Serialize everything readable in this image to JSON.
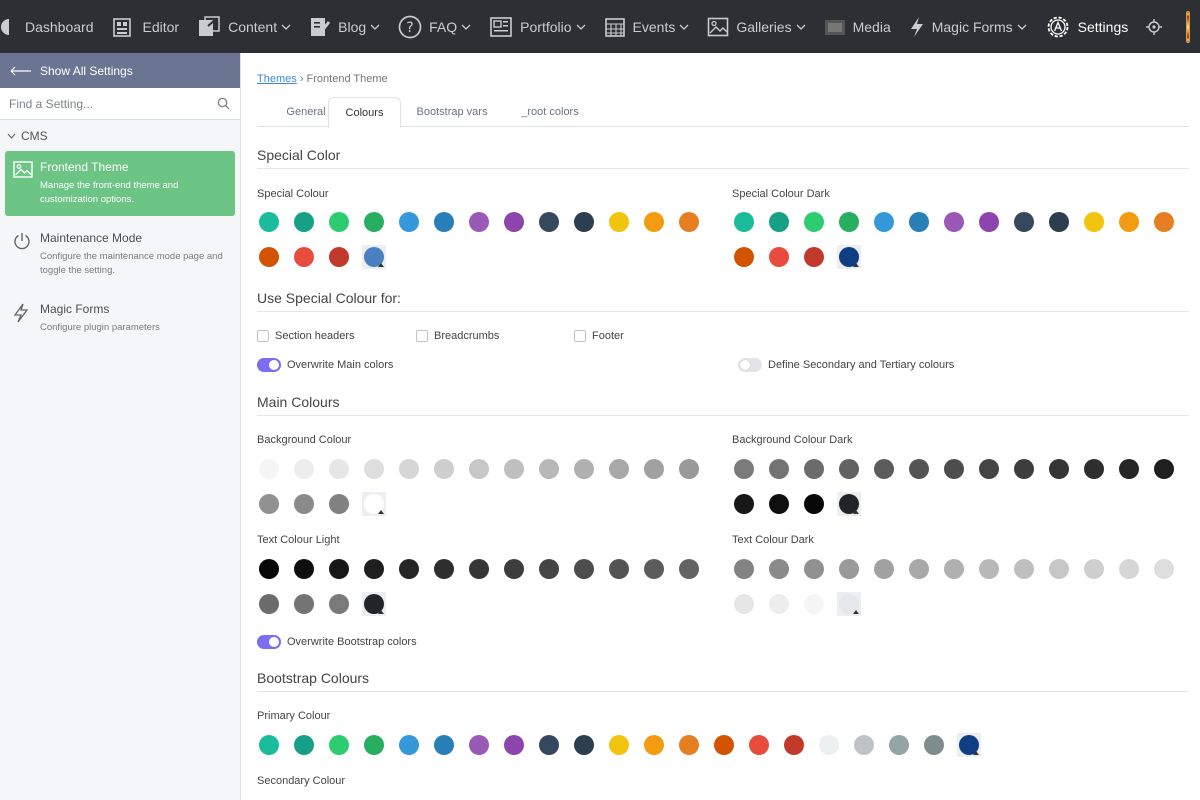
{
  "nav": {
    "items": [
      {
        "label": "Dashboard",
        "icon": "dashboard-icon",
        "dropdown": false
      },
      {
        "label": "Editor",
        "icon": "editor-icon",
        "dropdown": false
      },
      {
        "label": "Content",
        "icon": "content-icon",
        "dropdown": true
      },
      {
        "label": "Blog",
        "icon": "blog-icon",
        "dropdown": true
      },
      {
        "label": "FAQ",
        "icon": "question-circle-icon",
        "dropdown": true
      },
      {
        "label": "Portfolio",
        "icon": "portfolio-icon",
        "dropdown": true
      },
      {
        "label": "Events",
        "icon": "calendar-icon",
        "dropdown": true
      },
      {
        "label": "Galleries",
        "icon": "image-icon",
        "dropdown": true
      },
      {
        "label": "Media",
        "icon": "media-icon",
        "dropdown": false
      },
      {
        "label": "Magic Forms",
        "icon": "lightning-icon",
        "dropdown": true
      },
      {
        "label": "Settings",
        "icon": "gear-icon",
        "dropdown": false,
        "active": true
      }
    ]
  },
  "sidebar": {
    "show_all": "Show All Settings",
    "search_placeholder": "Find a Setting...",
    "group": "CMS",
    "items": [
      {
        "title": "Frontend Theme",
        "desc": "Manage the front-end theme and customization options.",
        "icon": "image-icon",
        "active": true
      },
      {
        "title": "Maintenance Mode",
        "desc": "Configure the maintenance mode page and toggle the setting.",
        "icon": "power-icon",
        "active": false
      },
      {
        "title": "Magic Forms",
        "desc": "Configure plugin parameters",
        "icon": "lightning-icon",
        "active": false
      }
    ]
  },
  "breadcrumb": {
    "link": "Themes",
    "sep": "›",
    "current": "Frontend Theme"
  },
  "tabs": [
    "General",
    "Colours",
    "Bootstrap vars",
    "_root colors"
  ],
  "active_tab": "Colours",
  "palettes": {
    "special": [
      "#1abc9c",
      "#16a085",
      "#2ecc71",
      "#27ae60",
      "#3498db",
      "#2980b9",
      "#9b59b6",
      "#8e44ad",
      "#34495e",
      "#2c3e50",
      "#f1c40f",
      "#f39c12",
      "#e67e22",
      "#d35400",
      "#e74c3c",
      "#c0392b"
    ],
    "bg_light": [
      "#f5f5f5",
      "#ededed",
      "#e6e6e6",
      "#dedede",
      "#d6d6d6",
      "#cfcfcf",
      "#c7c7c7",
      "#bfbfbf",
      "#b8b8b8",
      "#b0b0b0",
      "#a8a8a8",
      "#a1a1a1",
      "#999999",
      "#919191",
      "#8a8a8a",
      "#828282"
    ],
    "bg_dark": [
      "#7a7a7a",
      "#737373",
      "#6b6b6b",
      "#636363",
      "#5c5c5c",
      "#545454",
      "#4d4d4d",
      "#454545",
      "#3d3d3d",
      "#363636",
      "#2e2e2e",
      "#262626",
      "#1f1f1f",
      "#171717",
      "#0f0f0f",
      "#080808"
    ],
    "text_light": [
      "#080808",
      "#0f0f0f",
      "#171717",
      "#1f1f1f",
      "#262626",
      "#2e2e2e",
      "#363636",
      "#3d3d3d",
      "#454545",
      "#4d4d4d",
      "#545454",
      "#5c5c5c",
      "#636363",
      "#6b6b6b",
      "#737373",
      "#7a7a7a"
    ],
    "text_dark": [
      "#828282",
      "#8a8a8a",
      "#919191",
      "#999999",
      "#a1a1a1",
      "#a8a8a8",
      "#b0b0b0",
      "#b8b8b8",
      "#bfbfbf",
      "#c7c7c7",
      "#cfcfcf",
      "#d6d6d6",
      "#dedede",
      "#e6e6e6",
      "#ededed",
      "#f5f5f5"
    ],
    "primary": [
      "#1abc9c",
      "#16a085",
      "#2ecc71",
      "#27ae60",
      "#3498db",
      "#2980b9",
      "#9b59b6",
      "#8e44ad",
      "#34495e",
      "#2c3e50",
      "#f1c40f",
      "#f39c12",
      "#e67e22",
      "#d35400",
      "#e74c3c",
      "#c0392b",
      "#ecf0f1",
      "#bdc3c7",
      "#95a5a6",
      "#7f8c8d"
    ]
  },
  "sections": {
    "special": {
      "title": "Special Color",
      "left_label": "Special Colour",
      "left_custom": "#4a7fc1",
      "right_label": "Special Colour Dark",
      "right_custom": "#0f3f82"
    },
    "use_special": {
      "title": "Use Special Colour for:",
      "checks": [
        "Section headers",
        "Breadcrumbs",
        "Footer"
      ],
      "overwrite_main": "Overwrite Main colors",
      "define_secondary": "Define Secondary and Tertiary colours"
    },
    "main": {
      "title": "Main Colours",
      "bg_label": "Background Colour",
      "bg_custom": "#ffffff",
      "bg_dark_label": "Background Colour Dark",
      "bg_dark_custom": "#222528",
      "text_light_label": "Text Colour Light",
      "text_light_custom": "#222528",
      "text_dark_label": "Text Colour Dark",
      "text_dark_custom": "#e5e7ea",
      "overwrite_bootstrap": "Overwrite Bootstrap colors"
    },
    "bootstrap": {
      "title": "Bootstrap Colours",
      "primary_label": "Primary Colour",
      "primary_custom": "#0f3f82",
      "secondary_label": "Secondary Colour"
    }
  }
}
